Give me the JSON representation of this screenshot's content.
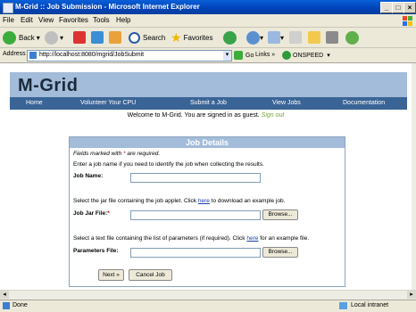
{
  "window": {
    "title": "M-Grid :: Job Submission - Microsoft Internet Explorer"
  },
  "menu": [
    "File",
    "Edit",
    "View",
    "Favorites",
    "Tools",
    "Help"
  ],
  "toolbar": {
    "back": "Back",
    "search": "Search",
    "favorites": "Favorites"
  },
  "address": {
    "label": "Address",
    "url": "http://localhost:8080/mgrid/JobSubmit",
    "go": "Go",
    "links": "Links",
    "plugin": "ONSPEED"
  },
  "site": {
    "logo": "M-Grid",
    "nav": [
      "Home",
      "Volunteer Your CPU",
      "Submit a Job",
      "View Jobs",
      "Documentation"
    ],
    "welcome_text": "Welcome to M-Grid. You are signed in as guest.",
    "sign_out": "Sign out"
  },
  "form": {
    "heading": "Job Details",
    "req_note_pre": "Fields marked with",
    "req_star": "*",
    "req_note_post": "are required.",
    "name_help": "Enter a job name if you need to identify the job when collecting the results.",
    "name_label": "Job Name:",
    "jar_help_pre": "Select the jar file containing the job applet. Click",
    "jar_help_link": "here",
    "jar_help_post": "to download an example job.",
    "jar_label": "Job Jar File:",
    "params_help_pre": "Select a text file containing the list of parameters (if required). Click",
    "params_help_link": "here",
    "params_help_post": "for an example file.",
    "params_label": "Parameters File:",
    "browse": "Browse...",
    "next": "Next »",
    "cancel": "Cancel Job"
  },
  "status": {
    "left": "Done",
    "zone": "Local intranet"
  }
}
